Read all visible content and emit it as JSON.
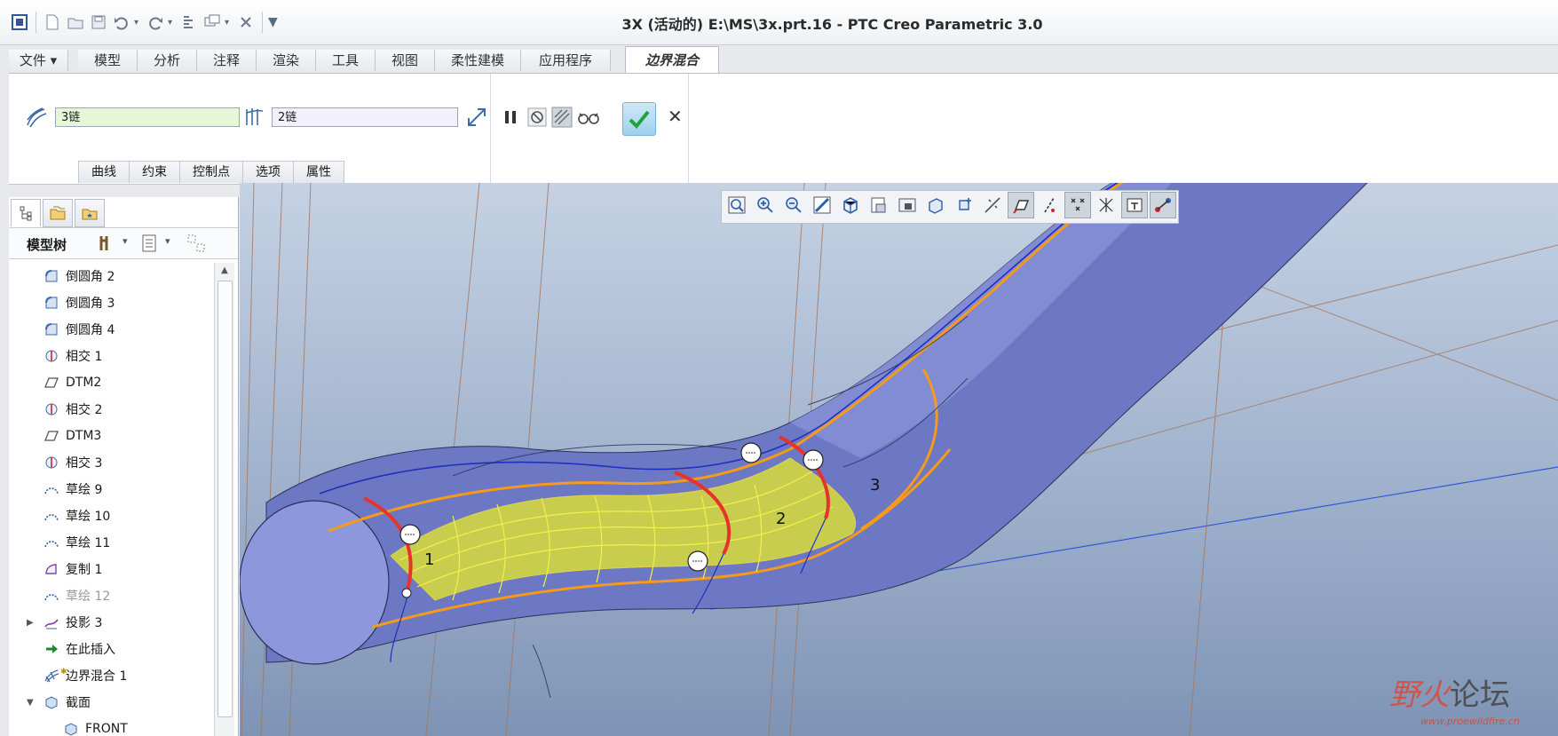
{
  "window": {
    "title": "3X (活动的) E:\\MS\\3x.prt.16 - PTC Creo Parametric 3.0"
  },
  "qat": {
    "icons": [
      "app-menu-icon",
      "new-file-icon",
      "open-file-icon",
      "save-icon",
      "undo-icon",
      "redo-icon",
      "regenerate-icon",
      "windows-icon",
      "close-window-icon",
      "customize-icon"
    ]
  },
  "ribbon_tabs": [
    {
      "label": "文件"
    },
    {
      "label": "模型"
    },
    {
      "label": "分析"
    },
    {
      "label": "注释"
    },
    {
      "label": "渲染"
    },
    {
      "label": "工具"
    },
    {
      "label": "视图"
    },
    {
      "label": "柔性建模"
    },
    {
      "label": "应用程序"
    },
    {
      "label": "边界混合"
    }
  ],
  "ribbon": {
    "first_direction_value": "3链",
    "second_direction_value": "2链",
    "subtabs": [
      {
        "label": "曲线"
      },
      {
        "label": "约束"
      },
      {
        "label": "控制点"
      },
      {
        "label": "选项"
      },
      {
        "label": "属性"
      }
    ]
  },
  "model_tree": {
    "header": "模型树",
    "items": [
      {
        "label": "倒圆角 2",
        "icon": "round-icon",
        "dim": false
      },
      {
        "label": "倒圆角 3",
        "icon": "round-icon",
        "dim": false
      },
      {
        "label": "倒圆角 4",
        "icon": "round-icon",
        "dim": false
      },
      {
        "label": "相交 1",
        "icon": "intersect-icon",
        "dim": false
      },
      {
        "label": "DTM2",
        "icon": "datum-plane-icon",
        "dim": false
      },
      {
        "label": "相交 2",
        "icon": "intersect-icon",
        "dim": false
      },
      {
        "label": "DTM3",
        "icon": "datum-plane-icon",
        "dim": false
      },
      {
        "label": "相交 3",
        "icon": "intersect-icon",
        "dim": false
      },
      {
        "label": "草绘 9",
        "icon": "sketch-icon",
        "dim": false
      },
      {
        "label": "草绘 10",
        "icon": "sketch-icon",
        "dim": false
      },
      {
        "label": "草绘 11",
        "icon": "sketch-icon",
        "dim": false
      },
      {
        "label": "复制 1",
        "icon": "copy-icon",
        "dim": false
      },
      {
        "label": "草绘 12",
        "icon": "sketch-icon",
        "dim": true
      },
      {
        "label": "投影 3",
        "icon": "projection-icon",
        "dim": false,
        "expandable": true
      },
      {
        "label": "在此插入",
        "icon": "insert-here-icon",
        "dim": false
      },
      {
        "label": "边界混合 1",
        "icon": "boundary-blend-icon",
        "dim": false
      },
      {
        "label": "截面",
        "icon": "section-icon",
        "dim": false,
        "expandable": true,
        "expanded": true
      },
      {
        "label": "FRONT",
        "icon": "section-icon",
        "dim": false,
        "child": true
      }
    ]
  },
  "viewport": {
    "curve_labels": [
      "1",
      "2",
      "3"
    ]
  },
  "watermark": {
    "text_a": "野火",
    "text_b": "论坛",
    "url": "www.proewildfire.cn"
  },
  "colors": {
    "accent_tab": "#ffffff",
    "surface_yellow": "#e3e03a",
    "boundary_red": "#e8322b",
    "edge_orange": "#f59a1b",
    "body_blue": "#6d78c4"
  }
}
